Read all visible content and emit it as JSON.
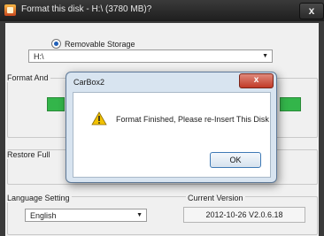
{
  "window": {
    "title": "Format this disk - H:\\ (3780 MB)?",
    "close_label": "x"
  },
  "storage": {
    "option_label": "Removable Storage",
    "drive_value": "H:\\"
  },
  "groups": {
    "format_label": "Format And",
    "restore_label": "Restore Full",
    "language_label": "Language Setting",
    "version_label": "Current Version"
  },
  "language": {
    "selected": "English"
  },
  "version": {
    "value": "2012-10-26 V2.0.6.18"
  },
  "dialog": {
    "title": "CarBox2",
    "close_label": "x",
    "message": "Format Finished, Please re-Insert This Disk",
    "ok_label": "OK"
  },
  "colors": {
    "progress": "#33b54a",
    "dialog_close": "#c13a28",
    "warning": "#f2c200"
  }
}
